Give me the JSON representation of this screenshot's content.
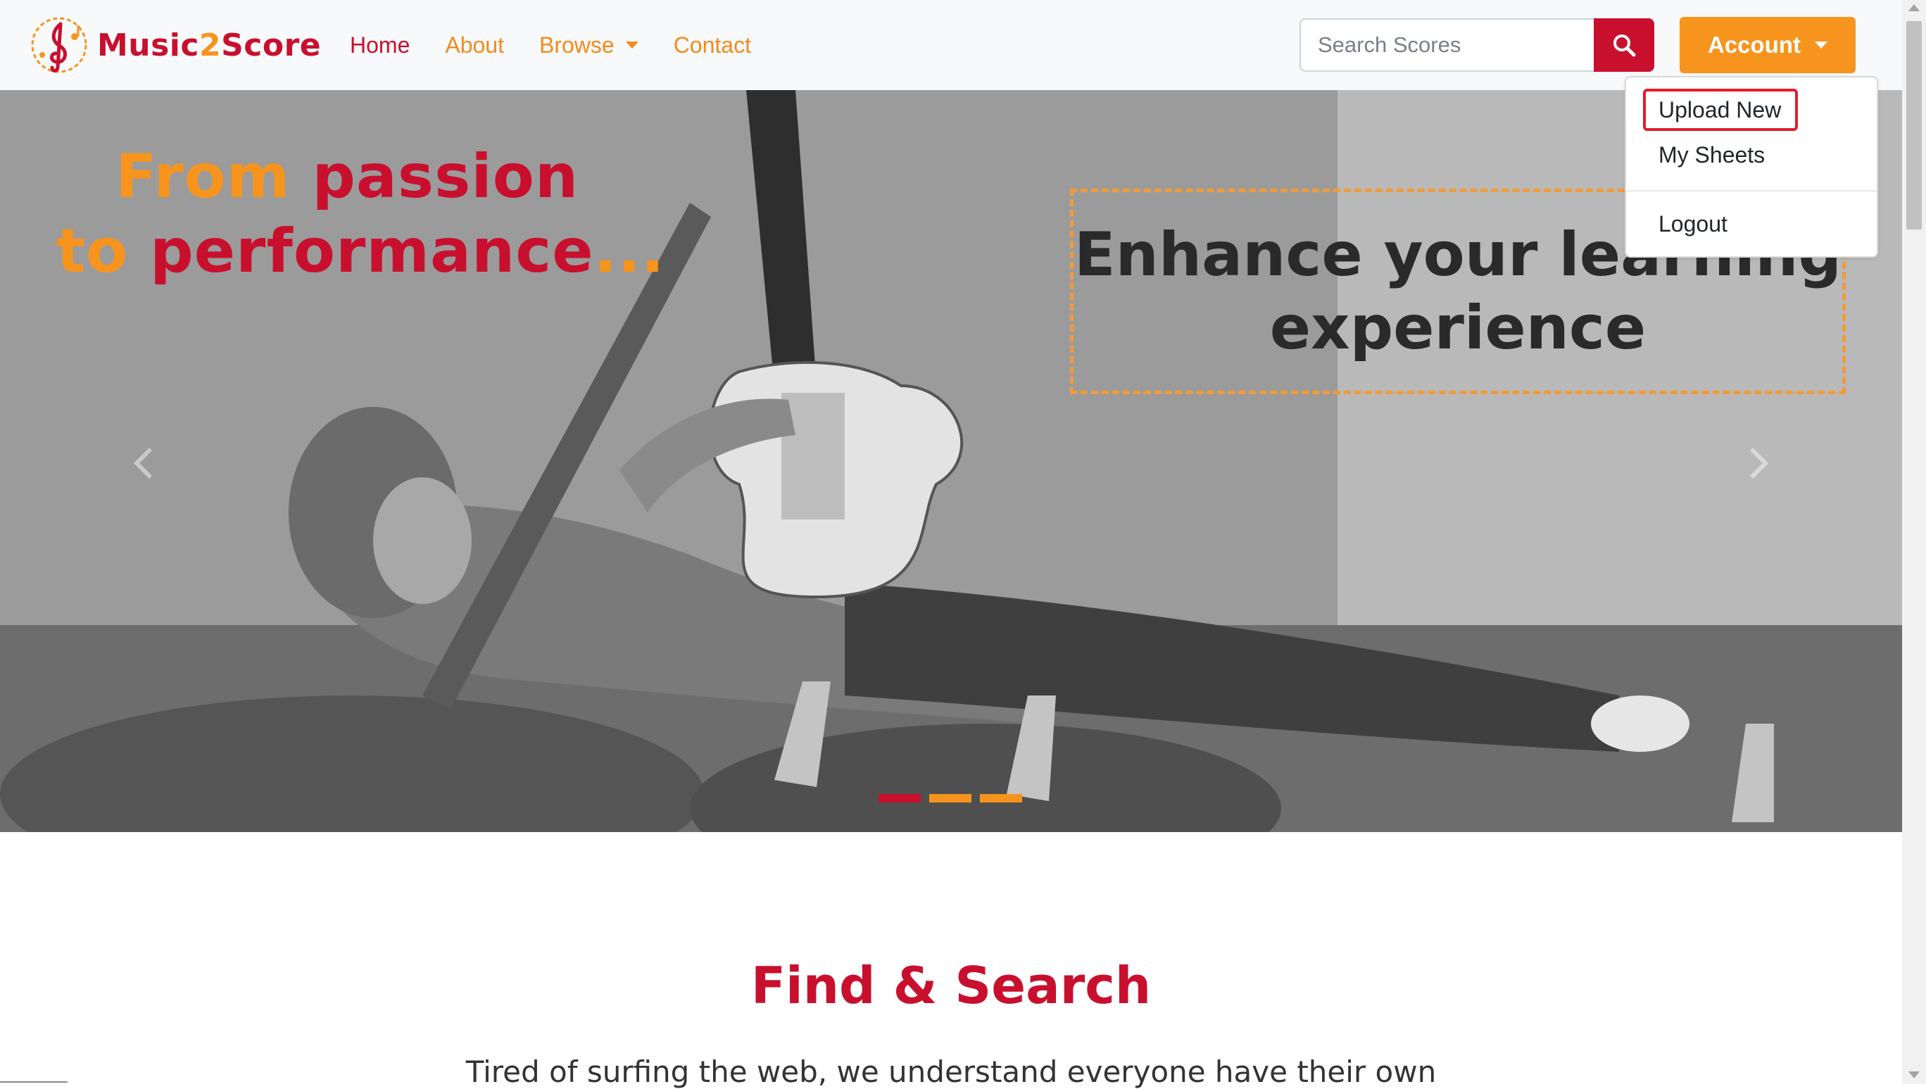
{
  "brand": {
    "name_part1": "Music",
    "name_part2": "2",
    "name_part3": "Score"
  },
  "nav": {
    "home": "Home",
    "about": "About",
    "browse": "Browse",
    "contact": "Contact"
  },
  "search": {
    "placeholder": "Search Scores",
    "value": ""
  },
  "account": {
    "label": "Account",
    "menu": {
      "upload_new": "Upload New",
      "my_sheets": "My Sheets",
      "logout": "Logout"
    }
  },
  "hero": {
    "tagline_line1_word1": "From",
    "tagline_line1_word2": "passion",
    "tagline_line2_word1": "to",
    "tagline_line2_word2": "performance",
    "tagline_line2_ellipsis": "...",
    "box_line1": "Enhance your learning",
    "box_line2": "experience",
    "slides_total": 3,
    "active_slide": 1
  },
  "content": {
    "section_title": "Find & Search",
    "intro_text": "Tired of surfing the web, we understand everyone have their own"
  },
  "colors": {
    "brand_red": "#c8102e",
    "brand_orange": "#f7941d",
    "highlight_red": "#e31c2a"
  },
  "icons": [
    "treble-clef-logo-icon",
    "search-icon",
    "chevron-left-icon",
    "chevron-right-icon"
  ]
}
